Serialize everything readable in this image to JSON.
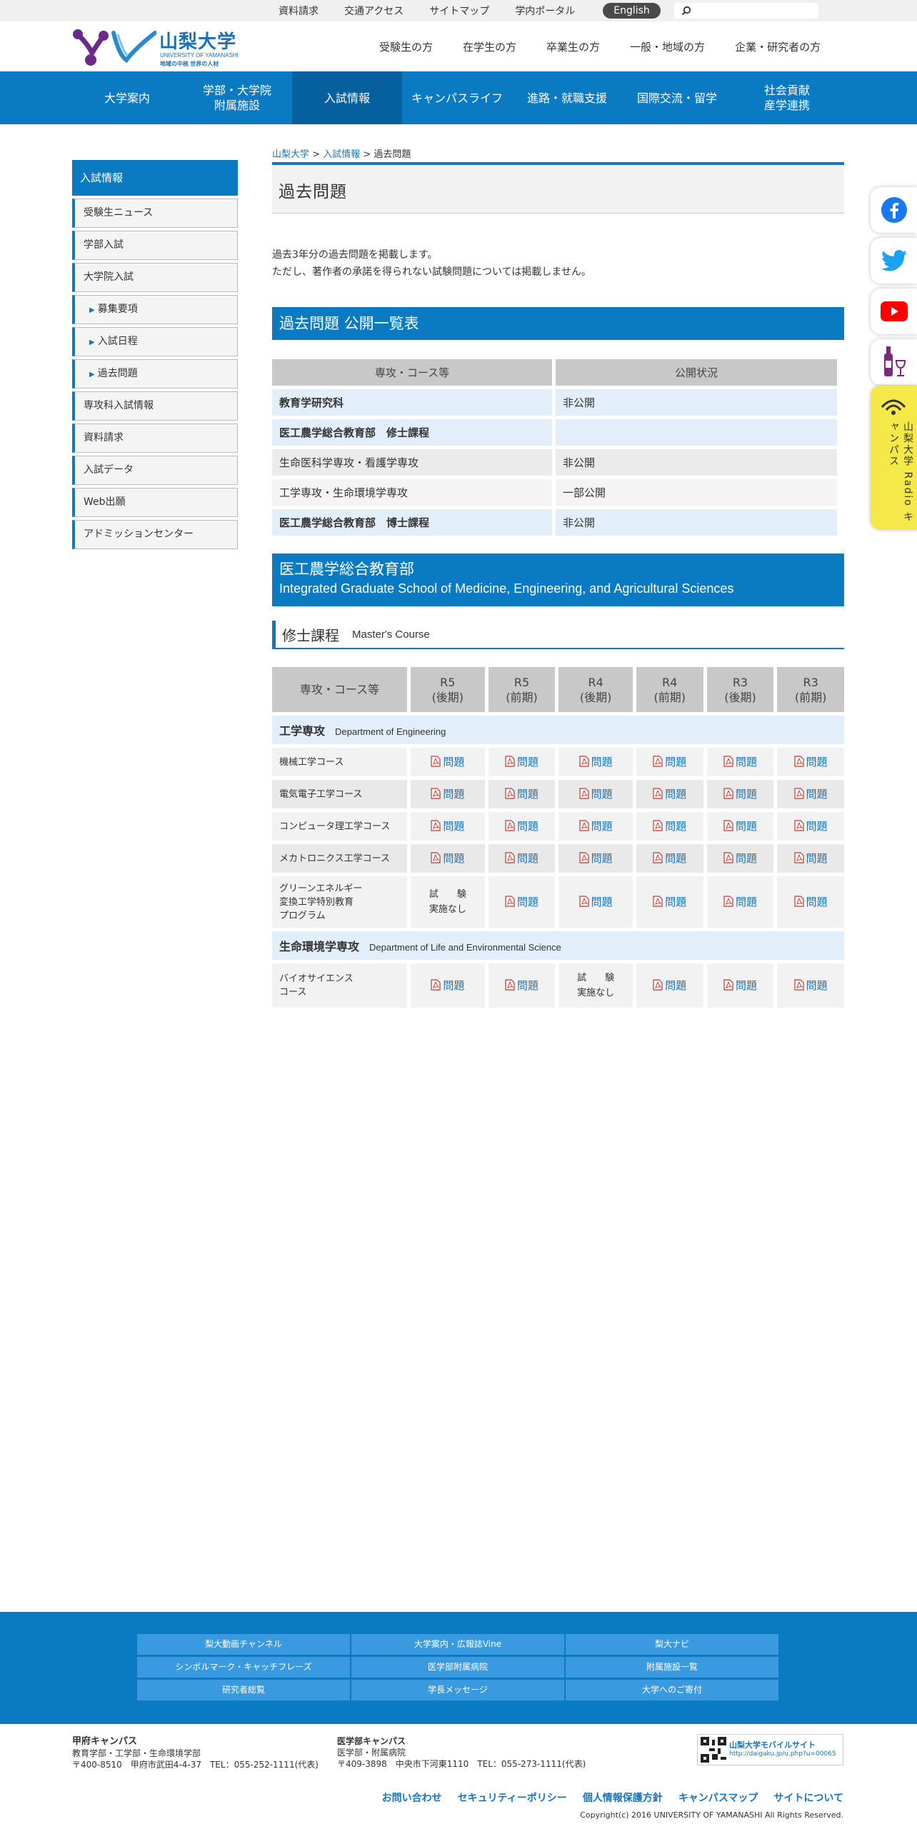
{
  "topbar": {
    "links": [
      "資料請求",
      "交通アクセス",
      "サイトマップ",
      "学内ポータル"
    ],
    "english_label": "English",
    "search_placeholder": ""
  },
  "header": {
    "logo_name": "山梨大学",
    "logo_sub": "UNIVERSITY OF YAMANASHI",
    "logo_tag": "地域の中核 世界の人材",
    "audience": [
      "受験生の方",
      "在学生の方",
      "卒業生の方",
      "一般・地域の方",
      "企業・研究者の方"
    ]
  },
  "mainnav": {
    "items": [
      "大学案内",
      "学部・大学院\n附属施設",
      "入試情報",
      "キャンパスライフ",
      "進路・就職支援",
      "国際交流・留学",
      "社会貢献\n産学連携"
    ]
  },
  "sidebar": {
    "heading": "入試情報",
    "items": [
      "受験生ニュース",
      "学部入試",
      "大学院入試"
    ],
    "subitems": [
      "募集要項",
      "入試日程",
      "過去問題"
    ],
    "items2": [
      "専攻科入試情報",
      "資料請求",
      "入試データ",
      "Web出願",
      "アドミッションセンター"
    ]
  },
  "breadcrumb": {
    "home": "山梨大学",
    "sep1": " > ",
    "parent": "入試情報",
    "sep2": " > ",
    "current": "過去問題"
  },
  "page": {
    "title": "過去問題",
    "intro1": "過去3年分の過去問題を掲載します。",
    "intro2": "ただし、著作者の承諾を得られない試験問題については掲載しません。"
  },
  "public_list": {
    "heading": "過去問題 公開一覧表",
    "col1": "専攻・コース等",
    "col2": "公開状況",
    "rows": [
      {
        "name": "教育学研究科",
        "status": "非公開"
      },
      {
        "name": "医工農学総合教育部　修士課程",
        "status": ""
      },
      {
        "name": "生命医科学専攻・看護学専攻",
        "status": "非公開"
      },
      {
        "name": "工学専攻・生命環境学専攻",
        "status": "一部公開"
      },
      {
        "name": "医工農学総合教育部　博士課程",
        "status": "非公開"
      }
    ]
  },
  "dept": {
    "title_ja": "医工農学総合教育部",
    "title_en": "Integrated Graduate School of Medicine, Engineering, and Agricultural Sciences"
  },
  "course": {
    "title_ja": "修士課程",
    "title_en": "Master's Course"
  },
  "exams": {
    "headers": [
      "専攻・コース等",
      "R5\n(後期)",
      "R5\n(前期)",
      "R4\n(後期)",
      "R4\n(前期)",
      "R3\n(後期)",
      "R3\n(前期)"
    ],
    "link_label": "問題",
    "none_label": "試　　験\n実施なし",
    "dept1": {
      "ja": "工学専攻",
      "en": "Department of Engineering"
    },
    "dept1_rows": [
      {
        "name": "機械工学コース"
      },
      {
        "name": "電気電子工学コース"
      },
      {
        "name": "コンピュータ理工学コース"
      },
      {
        "name": "メカトロニクス工学コース"
      },
      {
        "name": "グリーンエネルギー\n変換工学特別教育\nプログラム"
      }
    ],
    "dept2": {
      "ja": "生命環境学専攻",
      "en": "Department of Life and Environmental Science"
    },
    "dept2_rows": [
      {
        "name": "バイオサイエンス\nコース"
      }
    ]
  },
  "social": {
    "icons": [
      "facebook-icon",
      "twitter-icon",
      "youtube-icon",
      "wine-icon"
    ],
    "mobile_label": "山梨大学 Radio キャンパス"
  },
  "footer": {
    "grid": [
      "梨大動画チャンネル",
      "大学案内・広報誌Vine",
      "梨大ナビ",
      "シンボルマーク・キャッチフレーズ",
      "医学部附属病院",
      "附属施設一覧",
      "研究者総覧",
      "学長メッセージ",
      "大学へのご寄付"
    ],
    "campus1_name": "甲府キャンパス",
    "campus1_line1": "教育学部・工学部・生命環境学部",
    "campus1_line2": "〒400-8510　甲府市武田4-4-37　TEL：055-252-1111(代表)",
    "campus2_name": "医学部キャンパス",
    "campus2_line1": "医学部・附属病院",
    "campus2_line2": "〒409-3898　中央市下河東1110　TEL：055-273-1111(代表)",
    "qr_title": "山梨大学モバイルサイト",
    "qr_url": "http://daigaku.jp/u.php?u=00065",
    "links": [
      "お問い合わせ",
      "セキュリティーポリシー",
      "個人情報保護方針",
      "キャンパスマップ",
      "サイトについて"
    ],
    "copyright": "Copyright(c) 2016 UNIVERSITY OF YAMANASHI All Rights Reserved."
  },
  "colors": {
    "brand_blue": "#0a7ac2",
    "nav_active": "#06609e",
    "link": "#1a73b8"
  }
}
